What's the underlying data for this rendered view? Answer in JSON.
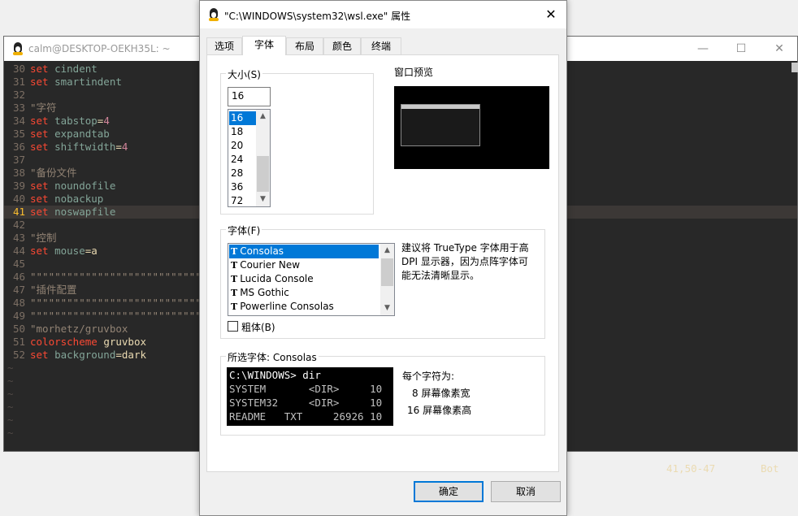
{
  "terminal": {
    "title": "calm@DESKTOP-OEKH35L: ~",
    "lines": [
      {
        "num": "30",
        "parts": [
          {
            "t": "set",
            "c": "kw"
          },
          {
            "t": " cindent",
            "c": "opt"
          }
        ]
      },
      {
        "num": "31",
        "parts": [
          {
            "t": "set",
            "c": "kw"
          },
          {
            "t": " smartindent",
            "c": "opt"
          }
        ]
      },
      {
        "num": "32",
        "parts": []
      },
      {
        "num": "33",
        "parts": [
          {
            "t": "\"字符",
            "c": "cmt"
          }
        ]
      },
      {
        "num": "34",
        "parts": [
          {
            "t": "set",
            "c": "kw"
          },
          {
            "t": " tabstop",
            "c": "opt"
          },
          {
            "t": "=",
            "c": "plain"
          },
          {
            "t": "4",
            "c": "num"
          }
        ]
      },
      {
        "num": "35",
        "parts": [
          {
            "t": "set",
            "c": "kw"
          },
          {
            "t": " expandtab",
            "c": "opt"
          }
        ]
      },
      {
        "num": "36",
        "parts": [
          {
            "t": "set",
            "c": "kw"
          },
          {
            "t": " shiftwidth",
            "c": "opt"
          },
          {
            "t": "=",
            "c": "plain"
          },
          {
            "t": "4",
            "c": "num"
          }
        ]
      },
      {
        "num": "37",
        "parts": []
      },
      {
        "num": "38",
        "parts": [
          {
            "t": "\"备份文件",
            "c": "cmt"
          }
        ]
      },
      {
        "num": "39",
        "parts": [
          {
            "t": "set",
            "c": "kw"
          },
          {
            "t": " noundofile",
            "c": "opt"
          }
        ]
      },
      {
        "num": "40",
        "parts": [
          {
            "t": "set",
            "c": "kw"
          },
          {
            "t": " nobackup",
            "c": "opt"
          }
        ]
      },
      {
        "num": "41",
        "parts": [
          {
            "t": "set",
            "c": "kw"
          },
          {
            "t": " noswapfile",
            "c": "opt"
          }
        ],
        "current": true
      },
      {
        "num": "42",
        "parts": []
      },
      {
        "num": "43",
        "parts": [
          {
            "t": "\"控制",
            "c": "cmt"
          }
        ]
      },
      {
        "num": "44",
        "parts": [
          {
            "t": "set",
            "c": "kw"
          },
          {
            "t": " mouse",
            "c": "opt"
          },
          {
            "t": "=",
            "c": "plain"
          },
          {
            "t": "a",
            "c": "plain"
          }
        ]
      },
      {
        "num": "45",
        "parts": []
      },
      {
        "num": "46",
        "parts": [
          {
            "t": "\"\"\"\"\"\"\"\"\"\"\"\"\"\"\"\"\"\"\"\"\"\"\"\"\"\"\"\"\"",
            "c": "cmt"
          }
        ]
      },
      {
        "num": "47",
        "parts": [
          {
            "t": "\"插件配置",
            "c": "cmt"
          }
        ]
      },
      {
        "num": "48",
        "parts": [
          {
            "t": "\"\"\"\"\"\"\"\"\"\"\"\"\"\"\"\"\"\"\"\"\"\"\"\"\"\"\"\"\"",
            "c": "cmt"
          }
        ]
      },
      {
        "num": "49",
        "parts": [
          {
            "t": "\"\"\"\"\"\"\"\"\"\"\"\"\"\"\"\"\"\"\"\"\"\"\"\"\"\"\"\"\"",
            "c": "cmt"
          }
        ]
      },
      {
        "num": "50",
        "parts": [
          {
            "t": "\"morhetz/gruvbox",
            "c": "cmt"
          }
        ]
      },
      {
        "num": "51",
        "parts": [
          {
            "t": "colorscheme",
            "c": "kw"
          },
          {
            "t": " gruvbox",
            "c": "plain"
          }
        ]
      },
      {
        "num": "52",
        "parts": [
          {
            "t": "set",
            "c": "kw"
          },
          {
            "t": " background",
            "c": "opt"
          },
          {
            "t": "=",
            "c": "plain"
          },
          {
            "t": "dark",
            "c": "plain"
          }
        ]
      }
    ],
    "tilde": "~",
    "status_pos": "41,50-47",
    "status_bot": "Bot",
    "controls": {
      "min": "—",
      "max": "☐",
      "close": "✕"
    }
  },
  "dialog": {
    "title": "\"C:\\WINDOWS\\system32\\wsl.exe\" 属性",
    "close": "✕",
    "tabs": [
      "选项",
      "字体",
      "布局",
      "颜色",
      "终端"
    ],
    "active_tab": 1,
    "size_group": "大小(S)",
    "size_value": "16",
    "sizes": [
      "16",
      "18",
      "20",
      "24",
      "28",
      "36",
      "72"
    ],
    "selected_size": "16",
    "preview_label": "窗口预览",
    "font_group": "字体(F)",
    "fonts": [
      "Consolas",
      "Courier New",
      "Lucida Console",
      "MS Gothic",
      "Powerline Consolas"
    ],
    "selected_font": "Consolas",
    "font_hint": [
      "建议将 TrueType 字体用于高",
      "DPI 显示器，因为点阵字体可",
      "能无法清晰显示。"
    ],
    "bold_label": "粗体(B)",
    "selected_font_group": "所选字体: Consolas",
    "preview_lines": [
      "C:\\WINDOWS> dir",
      "SYSTEM       <DIR>     10",
      "SYSTEM32     <DIR>     10",
      "README   TXT     26926 10"
    ],
    "char_info_title": "每个字符为:",
    "char_width": "8 屏幕像素宽",
    "char_height": "16 屏幕像素高",
    "ok": "确定",
    "cancel": "取消"
  },
  "colors": {
    "accent": "#0078d7",
    "vim_bg": "#282828",
    "vim_keyword": "#fb4934",
    "vim_option": "#83a598",
    "vim_number": "#d3869b",
    "vim_comment": "#928374",
    "vim_linenr_current": "#fabd2f"
  }
}
